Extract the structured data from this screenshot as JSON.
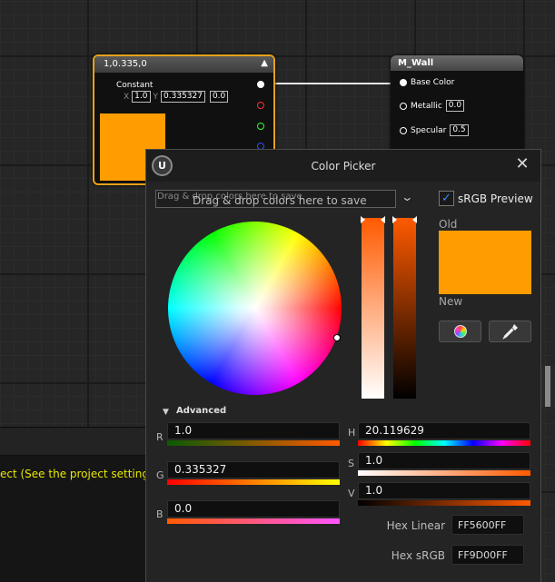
{
  "constant_node": {
    "title": "1,0.335,0",
    "collapse_icon": "caret-up-icon",
    "label": "Constant",
    "x_label": "X",
    "x_value": "1.0",
    "y_label": "Y",
    "y_value": "0.335327",
    "z_value": "0.0",
    "preview_color": "#ff9d00",
    "pin_colors": [
      "#ffffff",
      "#ff3030",
      "#30ff30",
      "#3050ff"
    ]
  },
  "material_node": {
    "title": "M_Wall",
    "inputs": [
      {
        "label": "Base Color",
        "value": ""
      },
      {
        "label": "Metallic",
        "value": "0.0"
      },
      {
        "label": "Specular",
        "value": "0.5"
      }
    ]
  },
  "status": {
    "message": "ect (See the project settings"
  },
  "picker": {
    "title": "Color Picker",
    "logo_icon": "unreal-logo-icon",
    "close_icon": "close-icon",
    "dropzone_text": "Drag & drop colors here to save",
    "dropzone_chevron_icon": "chevron-down-icon",
    "srgb_preview_label": "sRGB Preview",
    "srgb_preview_checked": true,
    "old_label": "Old",
    "new_label": "New",
    "old_color": "#ff9d00",
    "new_color": "#ff9d00",
    "palette_icon": "color-wheel-icon",
    "eyedropper_icon": "eyedropper-icon",
    "advanced_label": "Advanced",
    "channels": {
      "r": {
        "label": "R",
        "value": "1.0"
      },
      "g": {
        "label": "G",
        "value": "0.335327"
      },
      "b": {
        "label": "B",
        "value": "0.0"
      },
      "h": {
        "label": "H",
        "value": "20.119629"
      },
      "s": {
        "label": "S",
        "value": "1.0"
      },
      "v": {
        "label": "V",
        "value": "1.0"
      }
    },
    "hex_linear_label": "Hex Linear",
    "hex_linear_value": "FF5600FF",
    "hex_srgb_label": "Hex sRGB",
    "hex_srgb_value": "FF9D00FF"
  }
}
